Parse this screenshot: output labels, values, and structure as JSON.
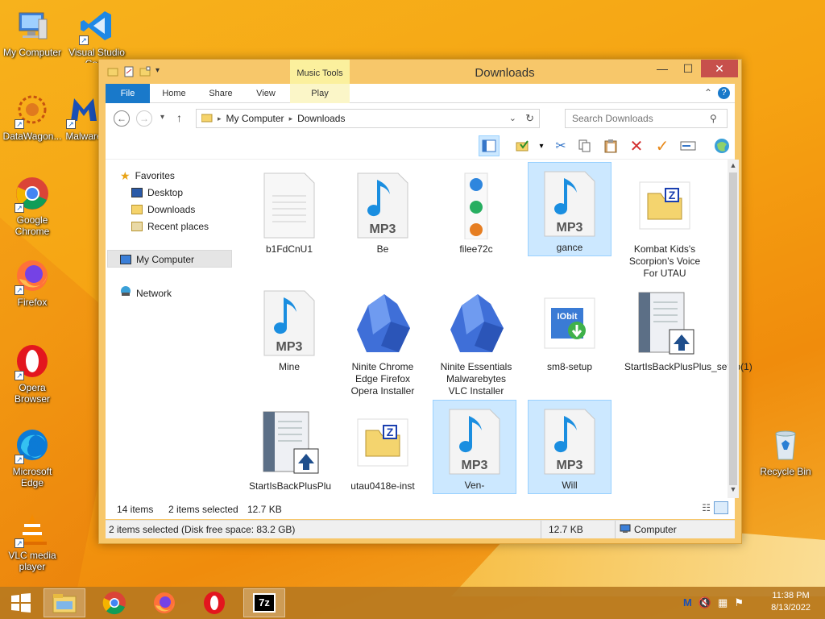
{
  "desktop": {
    "icons": [
      {
        "label": "My Computer"
      },
      {
        "label": "Visual Studio Code"
      },
      {
        "label": "DataWagon..."
      },
      {
        "label": "Malware"
      },
      {
        "label": "Google Chrome"
      },
      {
        "label": "Firefox"
      },
      {
        "label": "Opera Browser"
      },
      {
        "label": "Microsoft Edge"
      },
      {
        "label": "VLC media player"
      },
      {
        "label": "Recycle Bin"
      }
    ]
  },
  "window": {
    "title": "Downloads",
    "context_tab_header": "Music Tools",
    "ribbon_tabs": [
      "File",
      "Home",
      "Share",
      "View",
      "Play"
    ],
    "address": {
      "crumbs": [
        "My Computer",
        "Downloads"
      ],
      "search_placeholder": "Search Downloads"
    },
    "nav": {
      "favorites": "Favorites",
      "desktop": "Desktop",
      "downloads": "Downloads",
      "recent": "Recent places",
      "computer": "My Computer",
      "network": "Network"
    },
    "files": [
      {
        "name": "b1FdCnU1",
        "type": "blank",
        "selected": false
      },
      {
        "name": "Be",
        "type": "mp3",
        "selected": false
      },
      {
        "name": "filee72c",
        "type": "win",
        "selected": false
      },
      {
        "name": "gance",
        "type": "mp3",
        "selected": true
      },
      {
        "name": "Kombat Kids's Scorpion's Voice For UTAU",
        "type": "zip",
        "selected": false
      },
      {
        "name": "Mine",
        "type": "mp3",
        "selected": false
      },
      {
        "name": "Ninite Chrome Edge Firefox Opera Installer",
        "type": "ninite",
        "selected": false
      },
      {
        "name": "Ninite Essentials Malwarebytes VLC Installer",
        "type": "ninite",
        "selected": false
      },
      {
        "name": "sm8-setup",
        "type": "iobit",
        "selected": false
      },
      {
        "name": "StartIsBackPlusPlus_setup(1)",
        "type": "installer",
        "selected": false
      },
      {
        "name": "StartIsBackPlusPlus_setup",
        "type": "installer",
        "selected": false
      },
      {
        "name": "utau0418e-inst",
        "type": "zip",
        "selected": false
      },
      {
        "name": "Ven-",
        "type": "mp3",
        "selected": true
      },
      {
        "name": "Will",
        "type": "mp3",
        "selected": true
      }
    ],
    "status": {
      "item_count": "14 items",
      "selected_count": "2 items selected",
      "selected_size": "12.7 KB",
      "bottom_left": "2 items selected (Disk free space: 83.2 GB)",
      "bottom_size": "12.7 KB",
      "bottom_location": "Computer"
    }
  },
  "taskbar": {
    "time": "11:38 PM",
    "date": "8/13/2022"
  },
  "colors": {
    "accent": "#1979ca",
    "selection": "#cce8ff",
    "window_frame": "#f7c76a"
  }
}
